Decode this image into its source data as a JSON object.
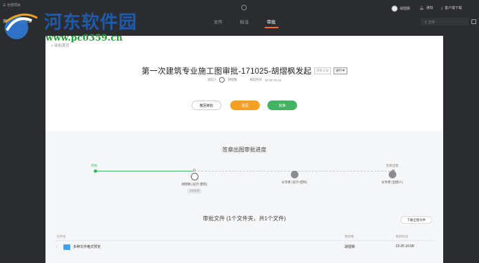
{
  "topbar": {
    "left_menu": "☰ 全部项目",
    "left_project": "第一次建筑施工",
    "tabs": [
      {
        "label": "文件",
        "active": false
      },
      {
        "label": "标注",
        "active": false
      },
      {
        "label": "审批",
        "active": true
      }
    ],
    "user": "胡熠枫",
    "notify": "通知",
    "download": "客户端下载",
    "search_placeholder": "文件"
  },
  "page": {
    "back": "< 审批首页",
    "title": "第一次建筑专业施工图审批-171025-胡熠枫发起",
    "badge_ghost": "审批记录",
    "badge_status": "进行中",
    "meta_initiator_label": "发起人",
    "meta_initiator": "胡熠枫",
    "meta_time_label": "发起时间",
    "meta_time": "10-25 16:15",
    "btn_reject": "撤回审批",
    "btn_return": "退回",
    "btn_approve": "批准"
  },
  "progress": {
    "title": "签章出图审批进度",
    "start": "开始",
    "end": "签章出图",
    "nodes": [
      {
        "name": "胡熠枫 (设计-建筑)",
        "tag": "当前处理"
      },
      {
        "name": "分享者 (设计-结构)"
      },
      {
        "name": "分享者 (出图人)"
      }
    ]
  },
  "files": {
    "title": "审批文件 (1个文件夹，共1个文件)",
    "download_all": "下载全部文件",
    "headers": {
      "name": "文件名",
      "updater": "更新者",
      "time": "更新时间"
    },
    "rows": [
      {
        "name": "多种文件格式预览",
        "updater": "胡熠枫",
        "time": "10-25 16:08"
      }
    ]
  },
  "watermark": {
    "text": "河东软件园",
    "url": "www.pc0359.cn"
  },
  "colors": {
    "accent": "#ff6a2b",
    "green": "#42b461",
    "orange": "#f5a023",
    "folder": "#3ea0f0"
  }
}
